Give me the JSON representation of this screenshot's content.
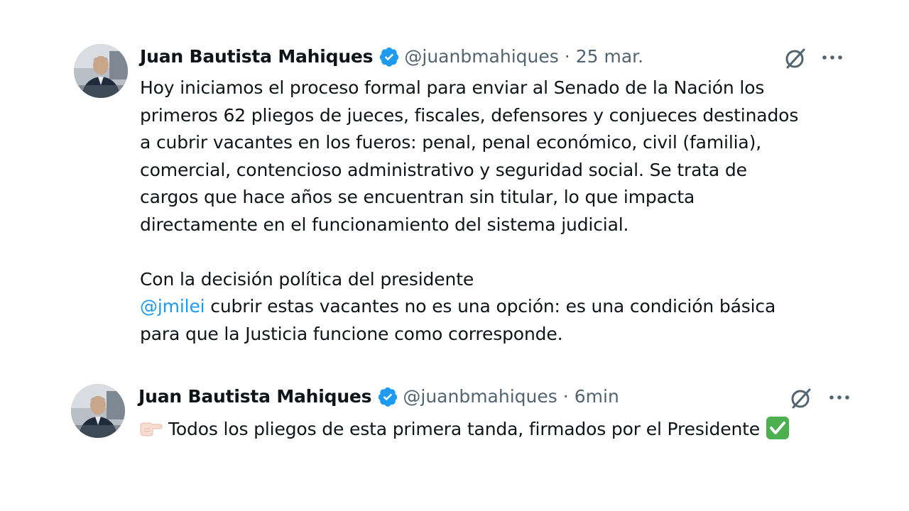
{
  "tweets": [
    {
      "author_name": "Juan Bautista Mahiques",
      "handle": "@juanbmahiques",
      "separator": "·",
      "time": "25 mar.",
      "body_lines": [
        "Hoy iniciamos el proceso formal para enviar al Senado de la Nación los",
        "primeros 62 pliegos de jueces, fiscales, defensores y conjueces destinados",
        "a cubrir vacantes en los fueros: penal, penal económico, civil (familia),",
        "comercial, contencioso administrativo y seguridad social. Se trata de",
        "cargos que hace años se encuentran sin titular, lo que impacta",
        "directamente en el funcionamiento del sistema judicial."
      ],
      "second_paragraph": {
        "line1": "Con la decisión política del presidente",
        "mention": "@jmilei",
        "line2_rest": " cubrir estas vacantes no es una opción: es una condición básica",
        "line3": "para que la Justicia funcione como corresponde."
      }
    },
    {
      "author_name": "Juan Bautista Mahiques",
      "handle": "@juanbmahiques",
      "separator": "·",
      "time": "6min",
      "body_text": "Todos los pliegos de esta primera tanda, firmados por el Presidente"
    }
  ],
  "icons": {
    "verified": "verified-badge-icon",
    "grok": "grok-icon",
    "more": "more-options-icon",
    "point_right": "backhand-index-pointing-right-emoji",
    "check": "check-mark-button-emoji"
  },
  "colors": {
    "text": "#0f1419",
    "secondary": "#536471",
    "link": "#1d9bf0",
    "verified": "#1d9bf0",
    "check_green": "#4caf50"
  }
}
